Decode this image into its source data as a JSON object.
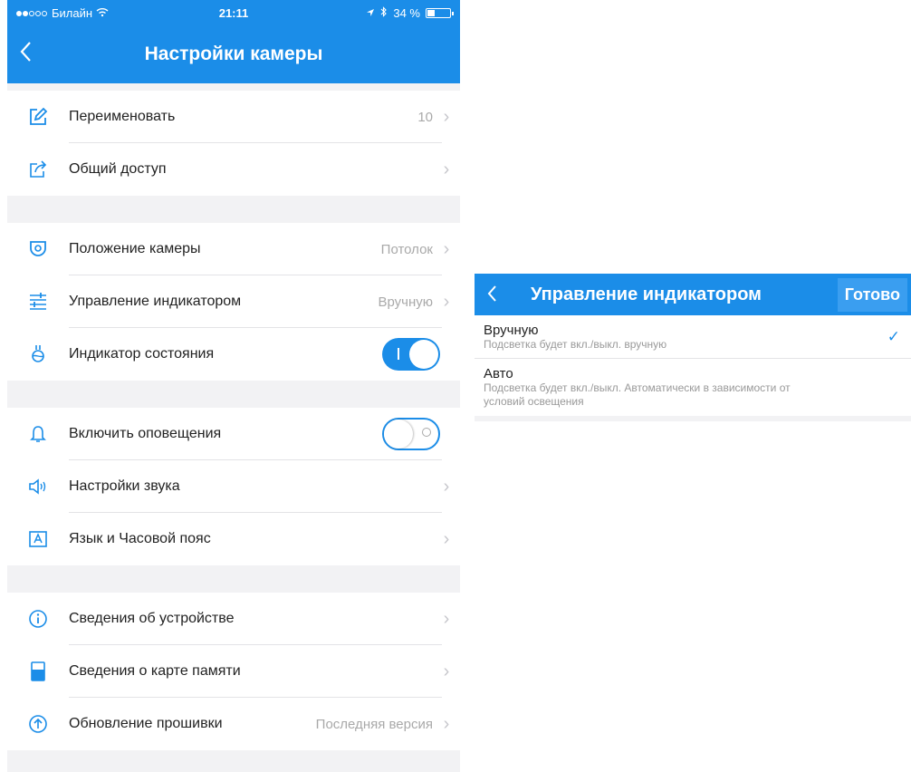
{
  "status_bar": {
    "carrier": "Билайн",
    "time": "21:11",
    "battery": "34 %",
    "battery_level": 0.34
  },
  "header": {
    "title": "Настройки камеры",
    "back_icon": "chevron-left-icon"
  },
  "sections": [
    [
      {
        "icon": "edit-icon",
        "label": "Переименовать",
        "value": "10",
        "chevron": true
      },
      {
        "icon": "share-icon",
        "label": "Общий доступ",
        "value": "",
        "chevron": true
      }
    ],
    [
      {
        "icon": "camera-position-icon",
        "label": "Положение камеры",
        "value": "Потолок",
        "chevron": true
      },
      {
        "icon": "sliders-icon",
        "label": "Управление индикатором",
        "value": "Вручную",
        "chevron": true
      },
      {
        "icon": "indicator-icon",
        "label": "Индикатор состояния",
        "toggle": "on"
      }
    ],
    [
      {
        "icon": "bell-icon",
        "label": "Включить оповещения",
        "toggle": "off"
      },
      {
        "icon": "speaker-icon",
        "label": "Настройки звука",
        "value": "",
        "chevron": true
      },
      {
        "icon": "language-icon",
        "label": "Язык и Часовой пояс",
        "value": "",
        "chevron": true
      }
    ],
    [
      {
        "icon": "info-icon",
        "label": "Сведения об устройстве",
        "value": "",
        "chevron": true
      },
      {
        "icon": "sd-card-icon",
        "label": "Сведения о карте памяти",
        "value": "",
        "chevron": true
      },
      {
        "icon": "upload-icon",
        "label": "Обновление прошивки",
        "value": "Последняя версия",
        "chevron": true
      }
    ]
  ],
  "panel": {
    "title": "Управление индикатором",
    "done_label": "Готово",
    "options": [
      {
        "title": "Вручную",
        "desc": "Подсветка будет вкл./выкл. вручную",
        "selected": true
      },
      {
        "title": "Авто",
        "desc": "Подсветка будет вкл./выкл. Автоматически в зависимости от условий освещения",
        "selected": false
      }
    ]
  },
  "colors": {
    "accent": "#1b8de8",
    "background": "#f2f2f4"
  }
}
